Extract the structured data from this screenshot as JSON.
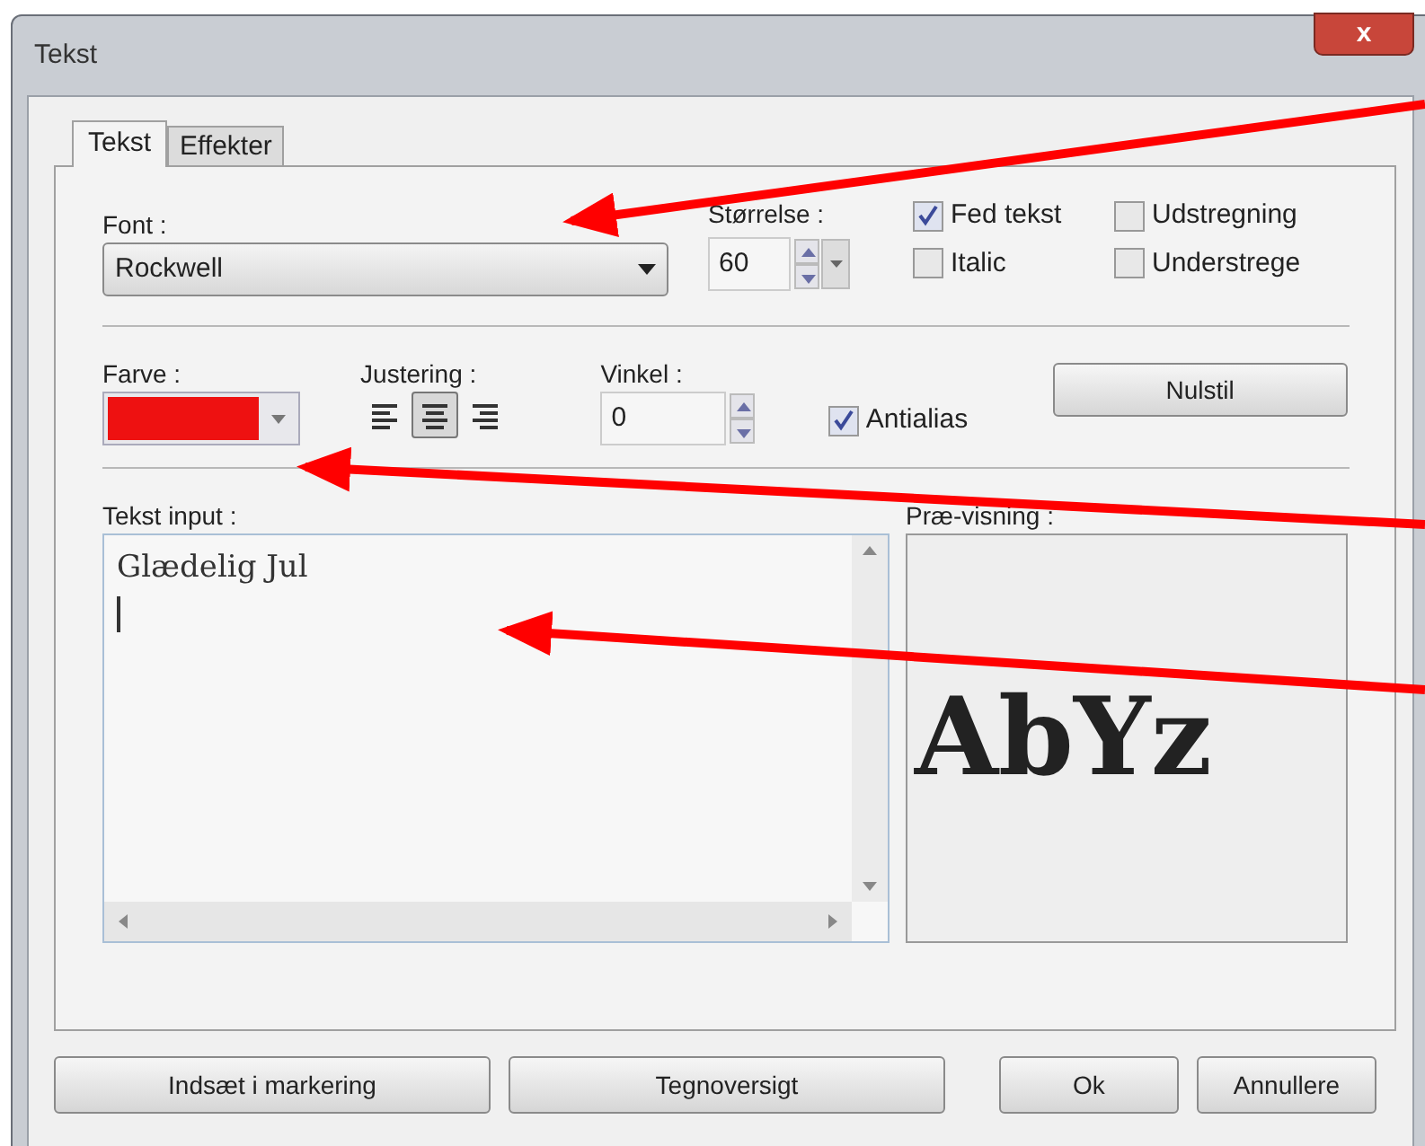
{
  "window": {
    "title": "Tekst",
    "close": "x"
  },
  "tabs": [
    {
      "label": "Tekst",
      "selected": true
    },
    {
      "label": "Effekter",
      "selected": false
    }
  ],
  "font": {
    "label": "Font :",
    "value": "Rockwell"
  },
  "size": {
    "label": "Størrelse :",
    "value": "60"
  },
  "styles": [
    {
      "label": "Fed tekst",
      "checked": true
    },
    {
      "label": "Udstregning",
      "checked": false
    },
    {
      "label": "Italic",
      "checked": false
    },
    {
      "label": "Understrege",
      "checked": false
    }
  ],
  "color": {
    "label": "Farve :",
    "color": "#ee1111"
  },
  "alignment": {
    "label": "Justering :",
    "options": [
      {
        "kind": "left",
        "selected": false
      },
      {
        "kind": "center",
        "selected": true
      },
      {
        "kind": "right",
        "selected": false
      }
    ]
  },
  "angle": {
    "label": "Vinkel :",
    "value": "0"
  },
  "antialias": {
    "label": "Antialias",
    "checked": true
  },
  "reset_button": "Nulstil",
  "text_input": {
    "label": "Tekst input :",
    "value": "Glædelig Jul"
  },
  "preview": {
    "label": "Præ-visning :",
    "sample": "AbYz"
  },
  "buttons": [
    {
      "label": "Indsæt i markering",
      "kind": "wide"
    },
    {
      "label": "Tegnoversigt",
      "kind": "wide"
    },
    {
      "label": "Ok",
      "kind": "narrow"
    },
    {
      "label": "Annullere",
      "kind": "narrow"
    }
  ]
}
